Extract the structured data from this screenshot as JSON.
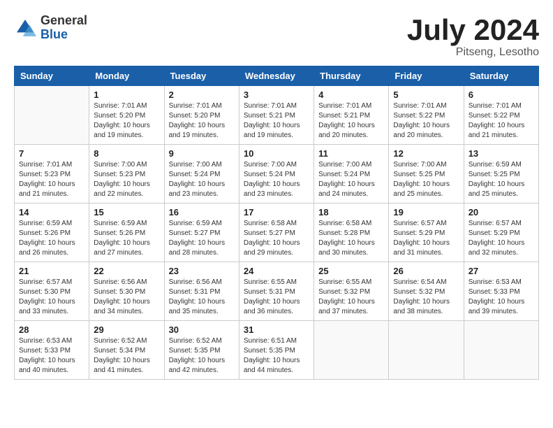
{
  "logo": {
    "general": "General",
    "blue": "Blue"
  },
  "title": "July 2024",
  "subtitle": "Pitseng, Lesotho",
  "days_of_week": [
    "Sunday",
    "Monday",
    "Tuesday",
    "Wednesday",
    "Thursday",
    "Friday",
    "Saturday"
  ],
  "weeks": [
    [
      {
        "day": "",
        "sunrise": "",
        "sunset": "",
        "daylight": ""
      },
      {
        "day": "1",
        "sunrise": "Sunrise: 7:01 AM",
        "sunset": "Sunset: 5:20 PM",
        "daylight": "Daylight: 10 hours and 19 minutes."
      },
      {
        "day": "2",
        "sunrise": "Sunrise: 7:01 AM",
        "sunset": "Sunset: 5:20 PM",
        "daylight": "Daylight: 10 hours and 19 minutes."
      },
      {
        "day": "3",
        "sunrise": "Sunrise: 7:01 AM",
        "sunset": "Sunset: 5:21 PM",
        "daylight": "Daylight: 10 hours and 19 minutes."
      },
      {
        "day": "4",
        "sunrise": "Sunrise: 7:01 AM",
        "sunset": "Sunset: 5:21 PM",
        "daylight": "Daylight: 10 hours and 20 minutes."
      },
      {
        "day": "5",
        "sunrise": "Sunrise: 7:01 AM",
        "sunset": "Sunset: 5:22 PM",
        "daylight": "Daylight: 10 hours and 20 minutes."
      },
      {
        "day": "6",
        "sunrise": "Sunrise: 7:01 AM",
        "sunset": "Sunset: 5:22 PM",
        "daylight": "Daylight: 10 hours and 21 minutes."
      }
    ],
    [
      {
        "day": "7",
        "sunrise": "Sunrise: 7:01 AM",
        "sunset": "Sunset: 5:23 PM",
        "daylight": "Daylight: 10 hours and 21 minutes."
      },
      {
        "day": "8",
        "sunrise": "Sunrise: 7:00 AM",
        "sunset": "Sunset: 5:23 PM",
        "daylight": "Daylight: 10 hours and 22 minutes."
      },
      {
        "day": "9",
        "sunrise": "Sunrise: 7:00 AM",
        "sunset": "Sunset: 5:24 PM",
        "daylight": "Daylight: 10 hours and 23 minutes."
      },
      {
        "day": "10",
        "sunrise": "Sunrise: 7:00 AM",
        "sunset": "Sunset: 5:24 PM",
        "daylight": "Daylight: 10 hours and 23 minutes."
      },
      {
        "day": "11",
        "sunrise": "Sunrise: 7:00 AM",
        "sunset": "Sunset: 5:24 PM",
        "daylight": "Daylight: 10 hours and 24 minutes."
      },
      {
        "day": "12",
        "sunrise": "Sunrise: 7:00 AM",
        "sunset": "Sunset: 5:25 PM",
        "daylight": "Daylight: 10 hours and 25 minutes."
      },
      {
        "day": "13",
        "sunrise": "Sunrise: 6:59 AM",
        "sunset": "Sunset: 5:25 PM",
        "daylight": "Daylight: 10 hours and 25 minutes."
      }
    ],
    [
      {
        "day": "14",
        "sunrise": "Sunrise: 6:59 AM",
        "sunset": "Sunset: 5:26 PM",
        "daylight": "Daylight: 10 hours and 26 minutes."
      },
      {
        "day": "15",
        "sunrise": "Sunrise: 6:59 AM",
        "sunset": "Sunset: 5:26 PM",
        "daylight": "Daylight: 10 hours and 27 minutes."
      },
      {
        "day": "16",
        "sunrise": "Sunrise: 6:59 AM",
        "sunset": "Sunset: 5:27 PM",
        "daylight": "Daylight: 10 hours and 28 minutes."
      },
      {
        "day": "17",
        "sunrise": "Sunrise: 6:58 AM",
        "sunset": "Sunset: 5:27 PM",
        "daylight": "Daylight: 10 hours and 29 minutes."
      },
      {
        "day": "18",
        "sunrise": "Sunrise: 6:58 AM",
        "sunset": "Sunset: 5:28 PM",
        "daylight": "Daylight: 10 hours and 30 minutes."
      },
      {
        "day": "19",
        "sunrise": "Sunrise: 6:57 AM",
        "sunset": "Sunset: 5:29 PM",
        "daylight": "Daylight: 10 hours and 31 minutes."
      },
      {
        "day": "20",
        "sunrise": "Sunrise: 6:57 AM",
        "sunset": "Sunset: 5:29 PM",
        "daylight": "Daylight: 10 hours and 32 minutes."
      }
    ],
    [
      {
        "day": "21",
        "sunrise": "Sunrise: 6:57 AM",
        "sunset": "Sunset: 5:30 PM",
        "daylight": "Daylight: 10 hours and 33 minutes."
      },
      {
        "day": "22",
        "sunrise": "Sunrise: 6:56 AM",
        "sunset": "Sunset: 5:30 PM",
        "daylight": "Daylight: 10 hours and 34 minutes."
      },
      {
        "day": "23",
        "sunrise": "Sunrise: 6:56 AM",
        "sunset": "Sunset: 5:31 PM",
        "daylight": "Daylight: 10 hours and 35 minutes."
      },
      {
        "day": "24",
        "sunrise": "Sunrise: 6:55 AM",
        "sunset": "Sunset: 5:31 PM",
        "daylight": "Daylight: 10 hours and 36 minutes."
      },
      {
        "day": "25",
        "sunrise": "Sunrise: 6:55 AM",
        "sunset": "Sunset: 5:32 PM",
        "daylight": "Daylight: 10 hours and 37 minutes."
      },
      {
        "day": "26",
        "sunrise": "Sunrise: 6:54 AM",
        "sunset": "Sunset: 5:32 PM",
        "daylight": "Daylight: 10 hours and 38 minutes."
      },
      {
        "day": "27",
        "sunrise": "Sunrise: 6:53 AM",
        "sunset": "Sunset: 5:33 PM",
        "daylight": "Daylight: 10 hours and 39 minutes."
      }
    ],
    [
      {
        "day": "28",
        "sunrise": "Sunrise: 6:53 AM",
        "sunset": "Sunset: 5:33 PM",
        "daylight": "Daylight: 10 hours and 40 minutes."
      },
      {
        "day": "29",
        "sunrise": "Sunrise: 6:52 AM",
        "sunset": "Sunset: 5:34 PM",
        "daylight": "Daylight: 10 hours and 41 minutes."
      },
      {
        "day": "30",
        "sunrise": "Sunrise: 6:52 AM",
        "sunset": "Sunset: 5:35 PM",
        "daylight": "Daylight: 10 hours and 42 minutes."
      },
      {
        "day": "31",
        "sunrise": "Sunrise: 6:51 AM",
        "sunset": "Sunset: 5:35 PM",
        "daylight": "Daylight: 10 hours and 44 minutes."
      },
      {
        "day": "",
        "sunrise": "",
        "sunset": "",
        "daylight": ""
      },
      {
        "day": "",
        "sunrise": "",
        "sunset": "",
        "daylight": ""
      },
      {
        "day": "",
        "sunrise": "",
        "sunset": "",
        "daylight": ""
      }
    ]
  ]
}
